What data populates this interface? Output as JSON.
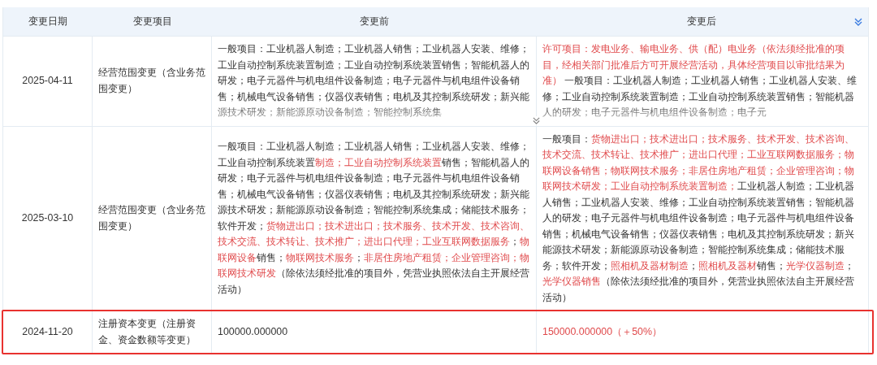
{
  "table": {
    "columns": [
      "变更日期",
      "变更项目",
      "变更前",
      "变更后"
    ],
    "rows": [
      {
        "date": "2025-04-11",
        "item": "经营范围变更（含业务范围变更）",
        "collapsed": true,
        "highlighted": false,
        "before": [
          {
            "text": "一般项目：工业机器人制造；工业机器人销售；工业机器人安装、维修；工业自动控制系统装置制造；工业自动控制系统装置销售；智能机器人的研发；电子元器件与机电组件设备制造；电子元器件与机电组件设备销售；机械电气设备销售；仪器仪表销售；电机及其控制系统研发；新兴能源技术研发；新能源原动设备制造；智能控制系统集",
            "changed": false
          }
        ],
        "after": [
          {
            "text": "许可项目：发电业务、输电业务、供（配）电业务（依法须经批准的项目，经相关部门批准后方可开展经营活动，具体经营项目以审批结果为准）",
            "changed": true
          },
          {
            "text": " 一般项目：工业机器人制造；工业机器人销售；工业机器人安装、维修；工业自动控制系统装置制造；工业自动控制系统装置销售；智能机器人的研发；电子元器件与机电组件设备制造；电子元",
            "changed": false
          }
        ]
      },
      {
        "date": "2025-03-10",
        "item": "经营范围变更（含业务范围变更）",
        "collapsed": false,
        "highlighted": false,
        "before": [
          {
            "text": "一般项目：工业机器人制造；工业机器人销售；工业机器人安装、维修；工业自动控制系统装置",
            "changed": false
          },
          {
            "text": "制造；工业自动控制系统装置",
            "changed": true
          },
          {
            "text": "销售；智能机器人的研发；电子元器件与机电组件设备制造；电子元器件与机电组件设备销售；机械电气设备销售；仪器仪表销售；电机及其控制系统研发；新兴能源技术研发；新能源原动设备制造；智能控制系统集成；储能技术服务；软件开发；",
            "changed": false
          },
          {
            "text": "货物进出口；技术进出口；技术服务、技术开发、技术咨询、技术交流、技术转让、技术推广；进出口代理；工业互联网数据服务",
            "changed": true
          },
          {
            "text": "；",
            "changed": false
          },
          {
            "text": "物联网设备",
            "changed": true
          },
          {
            "text": "销售；",
            "changed": false
          },
          {
            "text": "物联网技术服务",
            "changed": true
          },
          {
            "text": "；",
            "changed": false
          },
          {
            "text": "非居住房地产租赁；企业管理咨询；物联网技术研发",
            "changed": true
          },
          {
            "text": "（除依法须经批准的项目外，凭营业执照依法自主开展经营活动）",
            "changed": false
          }
        ],
        "after": [
          {
            "text": "一般项目：",
            "changed": false
          },
          {
            "text": "货物进出口；技术进出口；技术服务、技术开发、技术咨询、技术交流、技术转让、技术推广；进出口代理；工业互联网数据服务；物联网设备销售；物联网技术服务；非居住房地产租赁；企业管理咨询；物联网技术研发；工业自动控制系统装置制造；",
            "changed": true
          },
          {
            "text": "工业机器人制造；工业机器人销售；工业机器人安装、维修；工业自动控制系统装置销售；智能机器人的研发；电子元器件与机电组件设备制造；电子元器件与机电组件设备销售；机械电气设备销售；仪器仪表销售；电机及其控制系统研发；新兴能源技术研发；新能源原动设备制造；智能控制系统集成；储能技术服务；软件开发；",
            "changed": false
          },
          {
            "text": "照相机及器材制造",
            "changed": true
          },
          {
            "text": "；",
            "changed": false
          },
          {
            "text": "照相机及器材",
            "changed": true
          },
          {
            "text": "销售；",
            "changed": false
          },
          {
            "text": "光学仪器制造",
            "changed": true
          },
          {
            "text": "；",
            "changed": false
          },
          {
            "text": "光学仪器销售",
            "changed": true
          },
          {
            "text": "（除依法须经批准的项目外，凭营业执照依法自主开展经营活动）",
            "changed": false
          }
        ]
      },
      {
        "date": "2024-11-20",
        "item": "注册资本变更（注册资金、资金数额等变更）",
        "collapsed": false,
        "highlighted": true,
        "before": [
          {
            "text": "100000.000000",
            "changed": false
          }
        ],
        "after": [
          {
            "text": "150000.000000（＋50%）",
            "changed": true
          }
        ]
      }
    ]
  }
}
